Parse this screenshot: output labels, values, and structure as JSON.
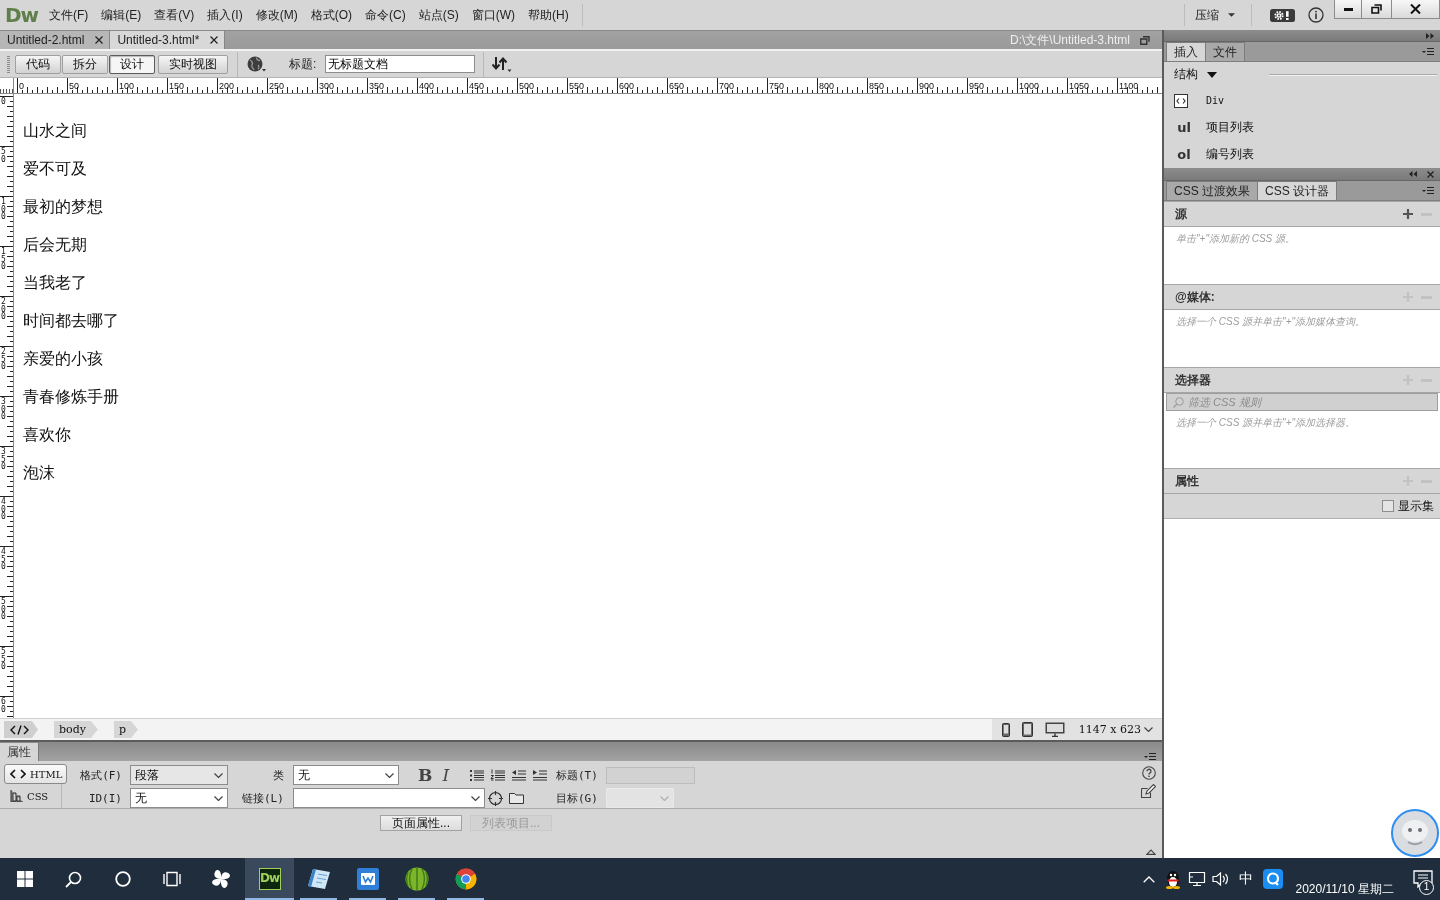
{
  "menu_bar": {
    "logo": "Dw",
    "items": [
      "文件(F)",
      "编辑(E)",
      "查看(V)",
      "插入(I)",
      "修改(M)",
      "格式(O)",
      "命令(C)",
      "站点(S)",
      "窗口(W)",
      "帮助(H)"
    ],
    "workspace": "压缩"
  },
  "document_tabs": [
    {
      "label": "Untitled-2.html",
      "selected": false
    },
    {
      "label": "Untitled-3.html*",
      "selected": true
    }
  ],
  "file_path": "D:\\文件\\Untitled-3.html",
  "document_toolbar": {
    "view_buttons": [
      {
        "label": "代码",
        "selected": false
      },
      {
        "label": "拆分",
        "selected": false
      },
      {
        "label": "设计",
        "selected": true
      },
      {
        "label": "实时视图",
        "selected": false
      }
    ],
    "title_label": "标题:",
    "title_value": "无标题文档"
  },
  "rulers": {
    "horizontal": [
      "0",
      "50",
      "100",
      "150",
      "200",
      "250",
      "300",
      "350",
      "400",
      "450",
      "500",
      "550",
      "600",
      "650",
      "700",
      "750",
      "800",
      "850",
      "900",
      "950",
      "1000",
      "1050",
      "1100"
    ],
    "vertical": [
      "0",
      "50",
      "100",
      "150",
      "200",
      "250",
      "300",
      "350",
      "400",
      "450",
      "500",
      "550",
      "60"
    ]
  },
  "canvas": {
    "paragraphs": [
      "山水之间",
      "爱不可及",
      "最初的梦想",
      "后会无期",
      "当我老了",
      "时间都去哪了",
      "亲爱的小孩",
      "青春修炼手册",
      "喜欢你",
      "泡沫"
    ]
  },
  "tag_selector": {
    "tags": [
      "body",
      "p"
    ],
    "window_size": "1147 x 623"
  },
  "properties": {
    "tab": "属性",
    "modes": [
      {
        "label": "HTML",
        "selected": true
      },
      {
        "label": "CSS",
        "selected": false
      }
    ],
    "format": {
      "label": "格式(F)",
      "value": "段落"
    },
    "id": {
      "label": "ID(I)",
      "value": "无"
    },
    "class": {
      "label": "类",
      "value": "无"
    },
    "link": {
      "label": "链接(L)"
    },
    "text_styles": [
      "B",
      "I"
    ],
    "heading": {
      "label": "标题(T)",
      "disabled": true
    },
    "target": {
      "label": "目标(G)",
      "disabled": true
    },
    "buttons": [
      {
        "label": "页面属性...",
        "disabled": false
      },
      {
        "label": "列表项目...",
        "disabled": true
      }
    ]
  },
  "insert_panel": {
    "tabs": [
      {
        "label": "插入",
        "selected": true
      },
      {
        "label": "文件",
        "selected": false
      }
    ],
    "category": "结构",
    "items": [
      {
        "kind": "icon",
        "label": "Div"
      },
      {
        "kind": "tag",
        "tag": "ul",
        "label": "项目列表"
      },
      {
        "kind": "tag",
        "tag": "ol",
        "label": "编号列表"
      }
    ]
  },
  "css_designer": {
    "tabs": [
      {
        "label": "CSS 过渡效果",
        "selected": false
      },
      {
        "label": "CSS 设计器",
        "selected": true
      }
    ],
    "sections": [
      {
        "title": "源",
        "add_enabled": true,
        "remove_enabled": false,
        "hint": "单击\"+\"添加新的 CSS 源。"
      },
      {
        "title": "@媒体:",
        "add_enabled": false,
        "remove_enabled": false,
        "hint": "选择一个 CSS 源并单击\"+\"添加媒体查询。"
      },
      {
        "title": "选择器",
        "add_enabled": false,
        "remove_enabled": false,
        "filter_placeholder": "筛选 CSS 规则",
        "hint": "选择一个 CSS 源并单击\"+\"添加选择器。"
      },
      {
        "title": "属性",
        "add_enabled": false,
        "remove_enabled": false,
        "show_set": {
          "label": "显示集",
          "checked": false
        }
      }
    ]
  },
  "taskbar": {
    "system_buttons": [
      {
        "kind": "start"
      },
      {
        "kind": "search"
      },
      {
        "kind": "cortana"
      },
      {
        "kind": "task-view"
      }
    ],
    "apps": [
      {
        "kind": "pinwheel",
        "running": false,
        "selected": false
      },
      {
        "kind": "dw",
        "label": "Dw",
        "running": true,
        "selected": true
      },
      {
        "kind": "notebook",
        "running": true,
        "selected": false
      },
      {
        "kind": "blue-tile",
        "running": true,
        "selected": false
      },
      {
        "kind": "melon",
        "running": true,
        "selected": false
      },
      {
        "kind": "chrome",
        "running": true,
        "selected": false
      }
    ],
    "tray": [
      {
        "kind": "chevron"
      },
      {
        "kind": "penguin"
      },
      {
        "kind": "network"
      },
      {
        "kind": "volume"
      }
    ],
    "ime": "中",
    "date": "2020/11/10 星期二",
    "notifications": "1"
  }
}
